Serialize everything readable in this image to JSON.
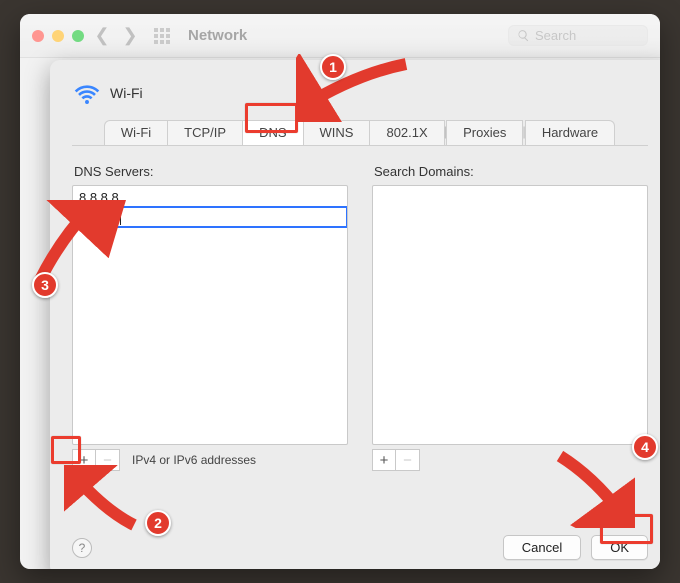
{
  "window": {
    "title": "Network",
    "search_placeholder": "Search",
    "traffic_lights": {
      "close": "#ff5f57",
      "min": "#ffbd2e",
      "max": "#28c840"
    }
  },
  "sheet": {
    "connection_name": "Wi-Fi",
    "tabs": [
      "Wi-Fi",
      "TCP/IP",
      "DNS",
      "WINS",
      "802.1X",
      "Proxies",
      "Hardware"
    ],
    "active_tab": "DNS",
    "left": {
      "label": "DNS Servers:",
      "items": [
        "8.8.8.8",
        "8.8.4.4"
      ],
      "editing_index": 1,
      "hint": "IPv4 or IPv6 addresses"
    },
    "right": {
      "label": "Search Domains:"
    },
    "add_label": "+",
    "remove_label": "−"
  },
  "footer": {
    "help_label": "?",
    "cancel": "Cancel",
    "ok": "OK"
  },
  "annotations": {
    "1": "1",
    "2": "2",
    "3": "3",
    "4": "4"
  },
  "colors": {
    "highlight": "#eb3c2e",
    "badge": "#e23a2d"
  }
}
